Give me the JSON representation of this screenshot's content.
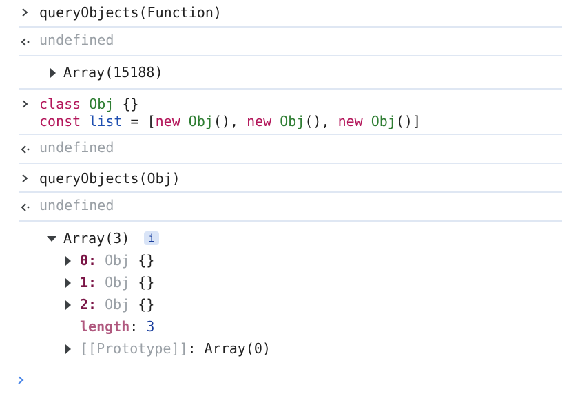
{
  "entries": [
    {
      "input": "queryObjects(Function)",
      "result": "undefined",
      "logged": "Array(15188)"
    },
    {
      "input_line1": [
        "class",
        "Obj",
        "{}"
      ],
      "input_line2": [
        "const",
        "list",
        "=",
        "[",
        "new",
        "Obj",
        "(),",
        "new",
        "Obj",
        "(),",
        "new",
        "Obj",
        "()]"
      ],
      "result": "undefined"
    },
    {
      "input": "queryObjects(Obj)",
      "result": "undefined",
      "logged": {
        "label": "Array(3)",
        "info_badge": "i",
        "items": [
          {
            "key": "0",
            "colon": ":",
            "type": "Obj",
            "value": "{}"
          },
          {
            "key": "1",
            "colon": ":",
            "type": "Obj",
            "value": "{}"
          },
          {
            "key": "2",
            "colon": ":",
            "type": "Obj",
            "value": "{}"
          }
        ],
        "length_key": "length",
        "length_colon": ":",
        "length_value": "3",
        "prototype_key": "[[Prototype]]",
        "prototype_colon": ":",
        "prototype_value": "Array(0)"
      }
    }
  ],
  "icons": {
    "input_prompt": "chevron-right-icon",
    "result_prompt": "result-arrow-icon",
    "expand_collapsed": "triangle-right-icon",
    "expand_open": "triangle-down-icon",
    "info": "info-icon"
  },
  "colors": {
    "prompt_active": "#4a86e8",
    "separator": "#dfe7f3",
    "keyword": "#b3165a",
    "classname": "#2e7d32"
  }
}
